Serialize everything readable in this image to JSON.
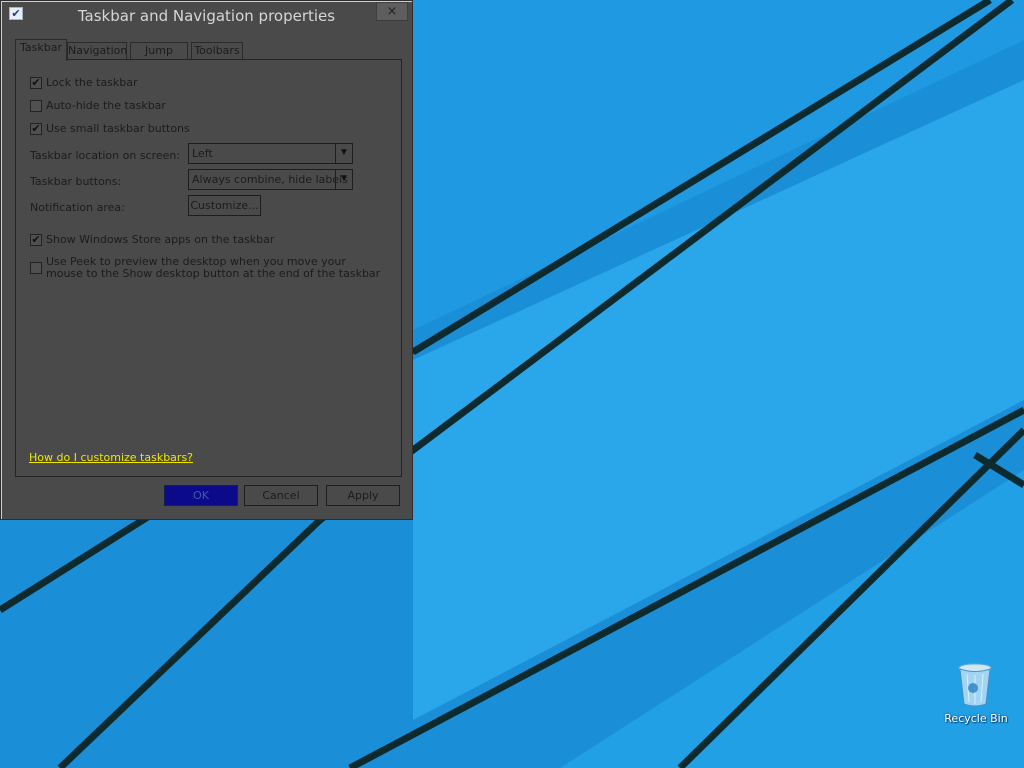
{
  "desktop": {
    "background_color": "#1a8fd8",
    "icons": [
      {
        "label": "Recycle Bin",
        "icon": "recycle-bin-icon"
      }
    ]
  },
  "dialog": {
    "title": "Taskbar and Navigation properties",
    "title_icon": "checkbox-app-icon",
    "close_label": "×",
    "tabs": [
      {
        "label": "Taskbar",
        "active": true
      },
      {
        "label": "Navigation",
        "active": false
      },
      {
        "label": "Jump Lists",
        "active": false
      },
      {
        "label": "Toolbars",
        "active": false
      }
    ],
    "checkboxes": [
      {
        "label": "Lock the taskbar",
        "checked": true
      },
      {
        "label": "Auto-hide the taskbar",
        "checked": false
      },
      {
        "label": "Use small taskbar buttons",
        "checked": true
      }
    ],
    "location": {
      "label": "Taskbar location on screen:",
      "value": "Left"
    },
    "buttons_setting": {
      "label": "Taskbar buttons:",
      "value": "Always combine, hide labels"
    },
    "notification": {
      "label": "Notification area:",
      "button": "Customize..."
    },
    "store_apps": {
      "label": "Show Windows Store apps on the taskbar",
      "checked": true
    },
    "peek": {
      "label": "Use Peek to preview the desktop when you move your mouse to the Show desktop button at the end of the taskbar",
      "checked": false
    },
    "help_link": "How do I customize taskbars?",
    "footer": {
      "ok": "OK",
      "cancel": "Cancel",
      "apply": "Apply"
    },
    "check_glyph": "✔",
    "dropdown_glyph": "▼"
  }
}
